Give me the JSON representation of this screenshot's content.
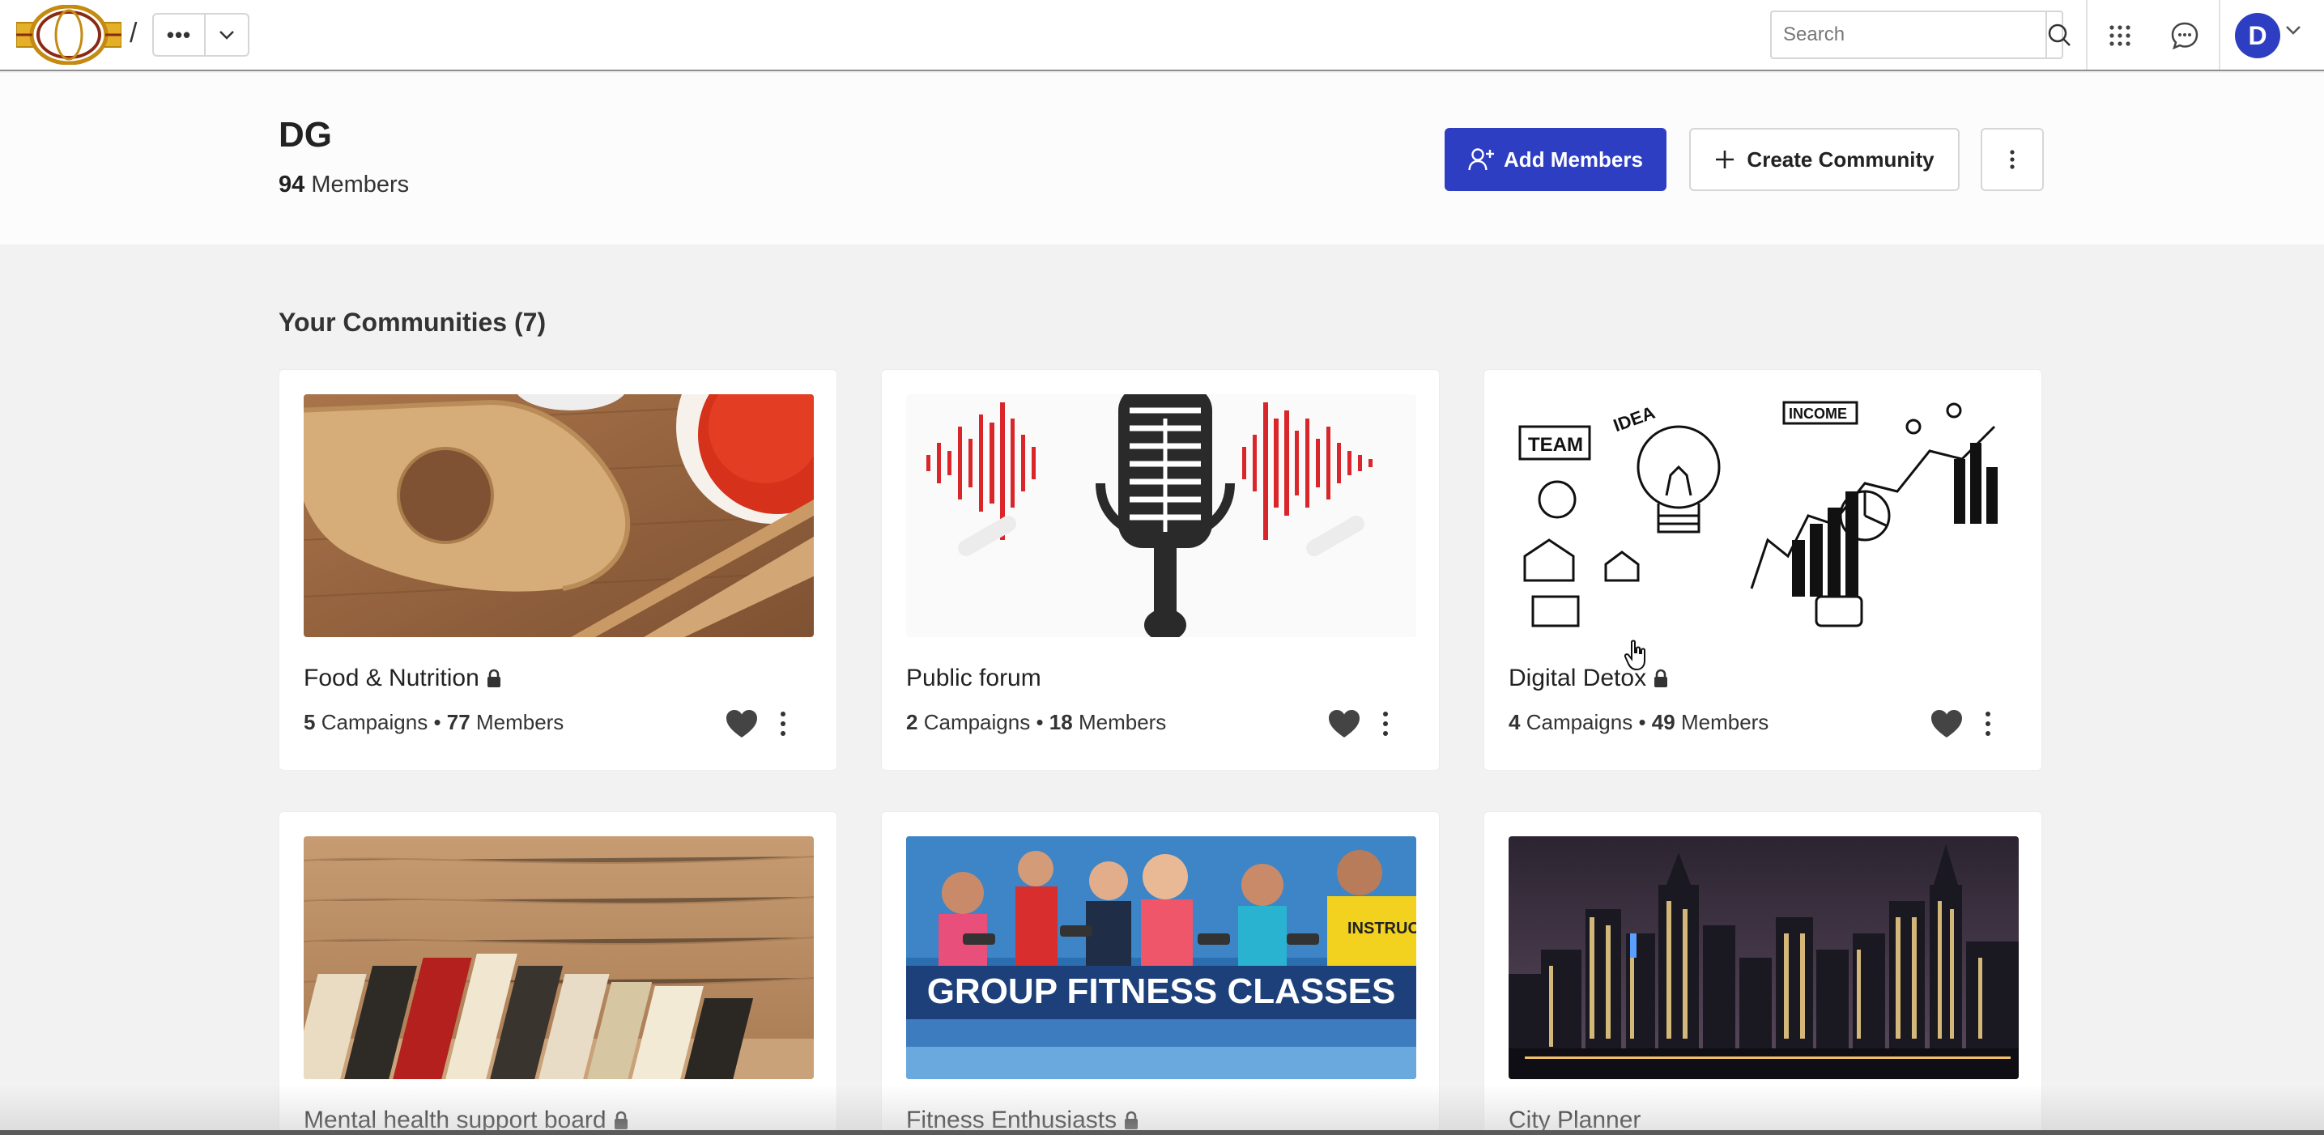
{
  "topbar": {
    "breadcrumb_separator": "/",
    "breadcrumb_more": "•••",
    "search_placeholder": "Search",
    "avatar_initial": "D",
    "icons": [
      "logo-icon",
      "chevron-down-icon",
      "search-icon",
      "apps-grid-icon",
      "chat-icon",
      "chevron-down-icon"
    ]
  },
  "header": {
    "title": "DG",
    "member_count": "94",
    "member_label": "Members",
    "add_members_label": "Add Members",
    "create_community_label": "Create Community"
  },
  "section": {
    "title": "Your Communities (7)"
  },
  "communities": [
    {
      "name": "Food & Nutrition",
      "locked": true,
      "campaigns": "5",
      "members": "77",
      "image": "wooden-spoons-and-paprika"
    },
    {
      "name": "Public forum",
      "locked": false,
      "campaigns": "2",
      "members": "18",
      "image": "microphone-sound-waves"
    },
    {
      "name": "Digital Detox",
      "locked": true,
      "campaigns": "4",
      "members": "49",
      "image": "idea-lightbulb-sketch"
    },
    {
      "name": "Mental health support board",
      "locked": true,
      "image": "books-on-wood"
    },
    {
      "name": "Fitness Enthusiasts",
      "locked": true,
      "image": "group-fitness-class"
    },
    {
      "name": "City Planner",
      "locked": false,
      "image": "night-city-skyline"
    }
  ],
  "labels": {
    "campaigns": "Campaigns",
    "members": "Members",
    "separator": "•"
  },
  "image_text": {
    "fitness_banner": "GROUP FITNESS CLASSES",
    "fitness_shirt": "INSTRUCT",
    "sketch_team": "TEAM",
    "sketch_idea": "IDEA",
    "sketch_income": "INCOME"
  },
  "colors": {
    "primary": "#2d3ec2",
    "background": "#f2f2f2"
  }
}
